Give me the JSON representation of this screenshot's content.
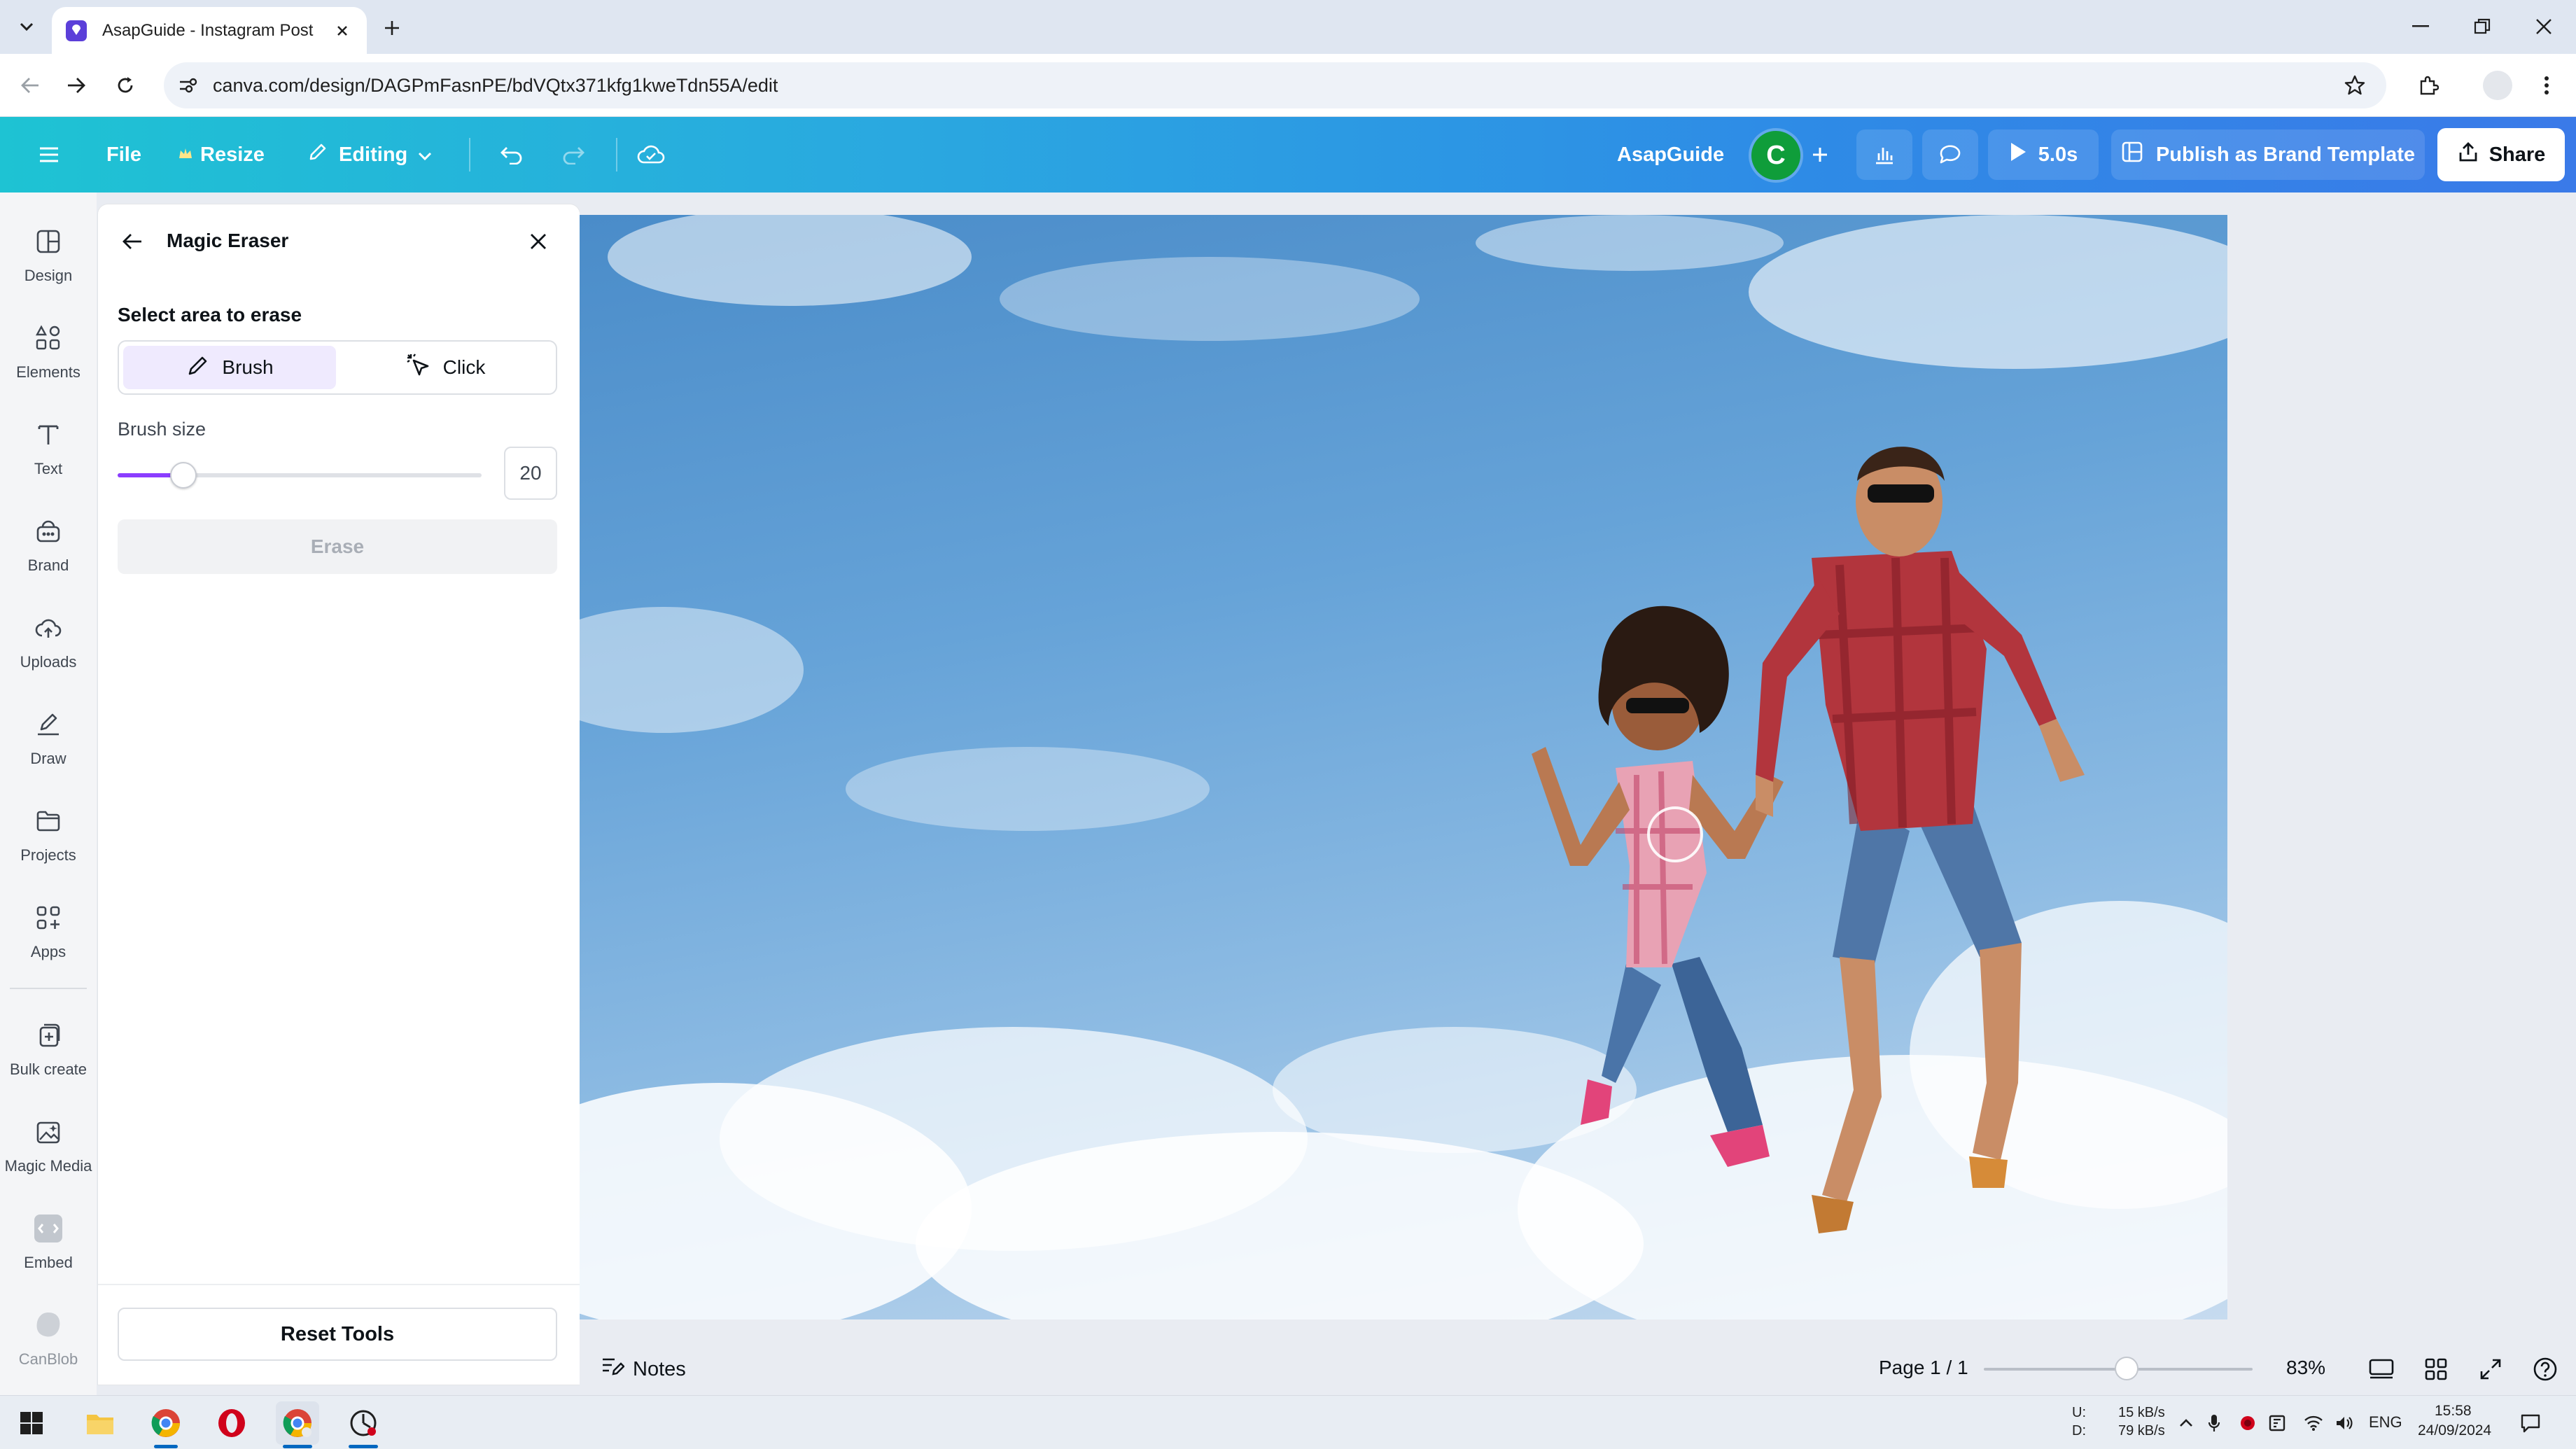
{
  "browser": {
    "tab_title": "AsapGuide - Instagram Post",
    "url": "canva.com/design/DAGPmFasnPE/bdVQtx371kfg1kweTdn55A/edit"
  },
  "header": {
    "file": "File",
    "resize": "Resize",
    "editing": "Editing",
    "design_name": "AsapGuide",
    "avatar_initial": "C",
    "play_duration": "5.0s",
    "publish": "Publish as Brand Template",
    "share": "Share"
  },
  "rail": {
    "design": "Design",
    "elements": "Elements",
    "text": "Text",
    "brand": "Brand",
    "uploads": "Uploads",
    "draw": "Draw",
    "projects": "Projects",
    "apps": "Apps",
    "bulk_create": "Bulk create",
    "magic_media": "Magic Media",
    "embed": "Embed",
    "canblob": "CanBlob"
  },
  "panel": {
    "title": "Magic Eraser",
    "subtitle": "Select area to erase",
    "mode_brush": "Brush",
    "mode_click": "Click",
    "brush_size_label": "Brush size",
    "brush_size_value": "20",
    "brush_size_fraction": 0.18,
    "erase": "Erase",
    "reset": "Reset Tools"
  },
  "bottom": {
    "notes": "Notes",
    "page_indicator": "Page 1 / 1",
    "zoom": "83%",
    "zoom_fraction": 0.53
  },
  "taskbar": {
    "net_up_label": "U:",
    "net_down_label": "D:",
    "net_up": "15 kB/s",
    "net_down": "79 kB/s",
    "lang": "ENG",
    "time": "15:58",
    "date": "24/09/2024"
  },
  "colors": {
    "accent": "#8b3dff",
    "header_gradient_start": "#1ec3d3",
    "header_gradient_end": "#3a7ae8"
  }
}
